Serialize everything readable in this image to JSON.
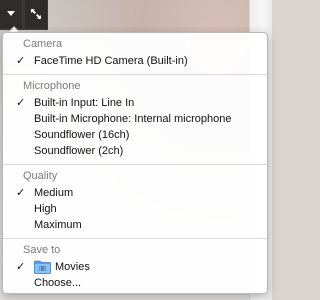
{
  "menu": {
    "camera": {
      "header": "Camera",
      "items": [
        {
          "label": "FaceTime HD Camera (Built-in)",
          "checked": true
        }
      ]
    },
    "microphone": {
      "header": "Microphone",
      "items": [
        {
          "label": "Built-in Input: Line In",
          "checked": true
        },
        {
          "label": "Built-in Microphone: Internal microphone",
          "checked": false
        },
        {
          "label": "Soundflower (16ch)",
          "checked": false
        },
        {
          "label": "Soundflower (2ch)",
          "checked": false
        }
      ]
    },
    "quality": {
      "header": "Quality",
      "items": [
        {
          "label": "Medium",
          "checked": true
        },
        {
          "label": "High",
          "checked": false
        },
        {
          "label": "Maximum",
          "checked": false
        }
      ]
    },
    "save_to": {
      "header": "Save to",
      "items": [
        {
          "label": "Movies",
          "checked": true,
          "icon": "folder-icon"
        },
        {
          "label": "Choose...",
          "checked": false
        }
      ]
    },
    "check_mark": "✓"
  },
  "colors": {
    "menu_background": "#ffffff",
    "header_text": "#7b7b7b",
    "item_text": "#111111",
    "folder_blue": "#6aa9e8"
  }
}
